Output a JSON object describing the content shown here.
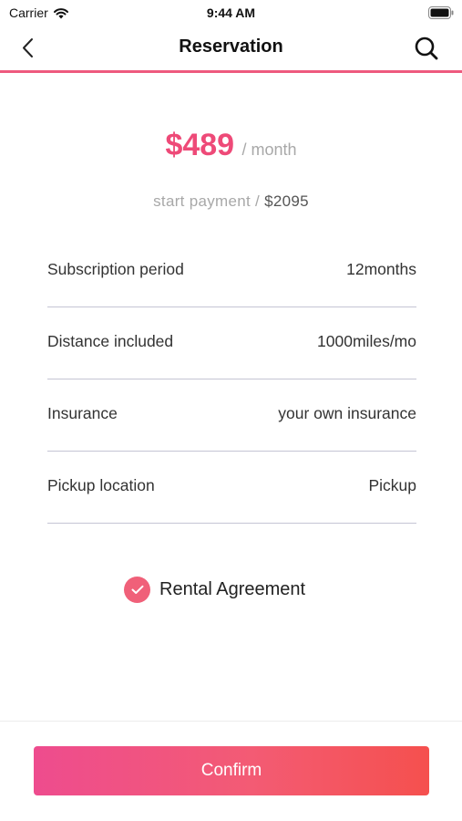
{
  "status_bar": {
    "carrier": "Carrier",
    "time": "9:44 AM"
  },
  "nav": {
    "title": "Reservation",
    "back_icon": "chevron-left-icon",
    "search_icon": "search-icon"
  },
  "price": {
    "amount": "$489",
    "unit": "/ month"
  },
  "start_payment": {
    "label": "start payment /",
    "value": "$2095"
  },
  "details": [
    {
      "label": "Subscription period",
      "value": "12months"
    },
    {
      "label": "Distance included",
      "value": "1000miles/mo"
    },
    {
      "label": "Insurance",
      "value": "your own insurance"
    },
    {
      "label": "Pickup location",
      "value": "Pickup"
    }
  ],
  "agreement": {
    "label": "Rental Agreement",
    "checked": true,
    "check_color": "#f06079"
  },
  "confirm": {
    "label": "Confirm"
  },
  "colors": {
    "accent": "#ee4a78",
    "nav_underline": "#ee5a7e",
    "button_gradient": [
      "#ee4c8e",
      "#f5504e"
    ]
  }
}
